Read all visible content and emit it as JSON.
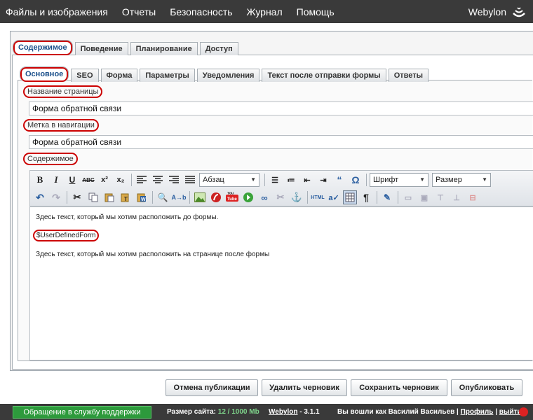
{
  "topnav": {
    "items": [
      "Файлы и изображения",
      "Отчеты",
      "Безопасность",
      "Журнал",
      "Помощь"
    ],
    "brand": "Webylon"
  },
  "tabs_main": [
    "Содержимое",
    "Поведение",
    "Планирование",
    "Доступ"
  ],
  "tabs_sub": [
    "Основное",
    "SEO",
    "Форма",
    "Параметры",
    "Уведомления",
    "Текст после отправки формы",
    "Ответы"
  ],
  "fields": {
    "page_name_label": "Название страницы",
    "page_name_value": "Форма обратной связи",
    "nav_label": "Метка в навигации",
    "nav_value": "Форма обратной связи",
    "content_label": "Содержимое"
  },
  "toolbar": {
    "format_select": "Абзац",
    "font_select": "Шрифт",
    "size_select": "Размер"
  },
  "editor": {
    "line1": "Здесь текст, который мы хотим расположить до формы.",
    "placeholder": "$UserDefinedForm",
    "line2": "Здесь текст, который мы хотим расположить на странице после формы"
  },
  "buttons": {
    "unpublish": "Отмена публикации",
    "delete_draft": "Удалить черновик",
    "save_draft": "Сохранить черновик",
    "publish": "Опубликовать"
  },
  "footer": {
    "support": "Обращение в службу поддержки",
    "size_label": "Размер сайта:",
    "size_value": "12 / 1000 Mb",
    "product": "Webylon",
    "version": "3.1.1",
    "logged_in": "Вы вошли как",
    "user_name": "Василий Васильев",
    "profile": "Профиль",
    "logout": "выйти"
  },
  "colors": {
    "topbar": "#3a3a3a",
    "highlight": "#cc0000",
    "support_bg": "#2d9a3c"
  }
}
